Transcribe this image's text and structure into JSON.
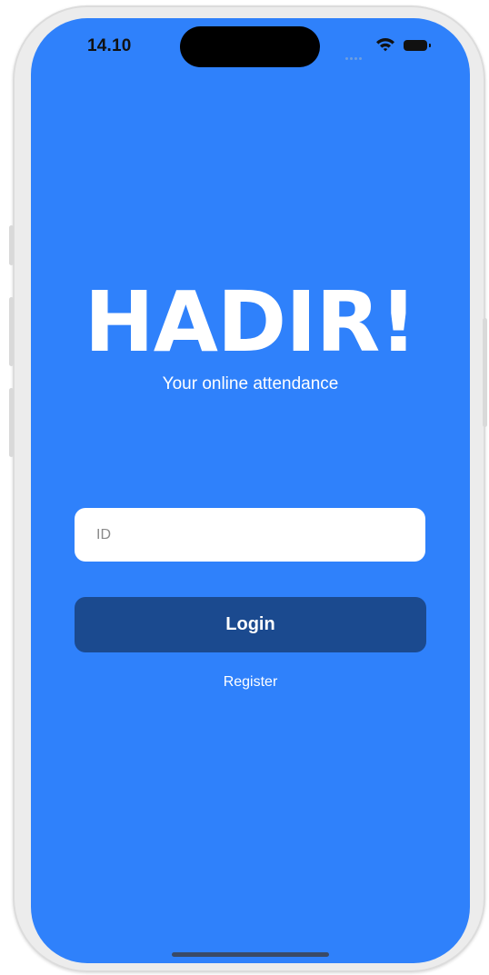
{
  "status_bar": {
    "time": "14.10",
    "icons": [
      "cellular-dots-icon",
      "wifi-icon",
      "battery-icon"
    ]
  },
  "app": {
    "title": "HADIR!",
    "subtitle": "Your online attendance"
  },
  "form": {
    "id_value": "",
    "id_placeholder": "ID",
    "login_label": "Login",
    "register_label": "Register"
  },
  "colors": {
    "background": "#2f81fb",
    "button": "#1b4a8f",
    "input": "#ffffff",
    "text": "#ffffff"
  }
}
